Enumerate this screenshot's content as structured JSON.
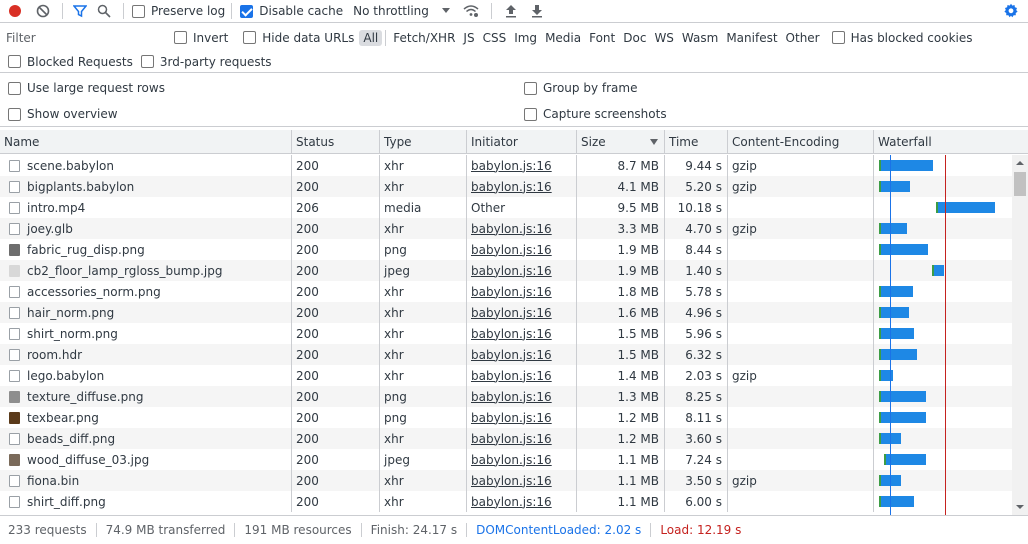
{
  "toolbar": {
    "preserve_log": "Preserve log",
    "disable_cache": "Disable cache",
    "throttling": "No throttling"
  },
  "filterbar": {
    "filter_placeholder": "Filter",
    "invert": "Invert",
    "hide_data_urls": "Hide data URLs",
    "types": [
      "All",
      "Fetch/XHR",
      "JS",
      "CSS",
      "Img",
      "Media",
      "Font",
      "Doc",
      "WS",
      "Wasm",
      "Manifest",
      "Other"
    ],
    "has_blocked_cookies": "Has blocked cookies",
    "blocked_requests": "Blocked Requests",
    "third_party": "3rd-party requests"
  },
  "settings": {
    "large_rows": "Use large request rows",
    "group_by_frame": "Group by frame",
    "show_overview": "Show overview",
    "capture_screenshots": "Capture screenshots"
  },
  "columns": [
    "Name",
    "Status",
    "Type",
    "Initiator",
    "Size",
    "Time",
    "Content-Encoding",
    "Waterfall"
  ],
  "colors": {
    "accent": "#1a73e8",
    "waterfall_bar": "#1e88e5",
    "waiting": "#3c9d45",
    "load": "#c5221f"
  },
  "rows": [
    {
      "name": "scene.babylon",
      "status": "200",
      "type": "xhr",
      "initiator": "babylon.js:16",
      "size": "8.7 MB",
      "time": "9.44 s",
      "encoding": "gzip",
      "icon": "doc",
      "start": 0.02,
      "dur": 0.39
    },
    {
      "name": "bigplants.babylon",
      "status": "200",
      "type": "xhr",
      "initiator": "babylon.js:16",
      "size": "4.1 MB",
      "time": "5.20 s",
      "encoding": "gzip",
      "icon": "doc",
      "start": 0.02,
      "dur": 0.22
    },
    {
      "name": "intro.mp4",
      "status": "206",
      "type": "media",
      "initiator": "Other",
      "size": "9.5 MB",
      "time": "10.18 s",
      "encoding": "",
      "icon": "doc",
      "start": 0.45,
      "dur": 0.42
    },
    {
      "name": "joey.glb",
      "status": "200",
      "type": "xhr",
      "initiator": "babylon.js:16",
      "size": "3.3 MB",
      "time": "4.70 s",
      "encoding": "gzip",
      "icon": "doc",
      "start": 0.02,
      "dur": 0.2
    },
    {
      "name": "fabric_rug_disp.png",
      "status": "200",
      "type": "png",
      "initiator": "babylon.js:16",
      "size": "1.9 MB",
      "time": "8.44 s",
      "encoding": "",
      "icon": "img-dark",
      "start": 0.02,
      "dur": 0.35
    },
    {
      "name": "cb2_floor_lamp_rgloss_bump.jpg",
      "status": "200",
      "type": "jpeg",
      "initiator": "babylon.js:16",
      "size": "1.9 MB",
      "time": "1.40 s",
      "encoding": "",
      "icon": "img-light",
      "start": 0.42,
      "dur": 0.07
    },
    {
      "name": "accessories_norm.png",
      "status": "200",
      "type": "xhr",
      "initiator": "babylon.js:16",
      "size": "1.8 MB",
      "time": "5.78 s",
      "encoding": "",
      "icon": "doc",
      "start": 0.02,
      "dur": 0.24
    },
    {
      "name": "hair_norm.png",
      "status": "200",
      "type": "xhr",
      "initiator": "babylon.js:16",
      "size": "1.6 MB",
      "time": "4.96 s",
      "encoding": "",
      "icon": "doc",
      "start": 0.02,
      "dur": 0.21
    },
    {
      "name": "shirt_norm.png",
      "status": "200",
      "type": "xhr",
      "initiator": "babylon.js:16",
      "size": "1.5 MB",
      "time": "5.96 s",
      "encoding": "",
      "icon": "doc",
      "start": 0.02,
      "dur": 0.25
    },
    {
      "name": "room.hdr",
      "status": "200",
      "type": "xhr",
      "initiator": "babylon.js:16",
      "size": "1.5 MB",
      "time": "6.32 s",
      "encoding": "",
      "icon": "doc",
      "start": 0.02,
      "dur": 0.27
    },
    {
      "name": "lego.babylon",
      "status": "200",
      "type": "xhr",
      "initiator": "babylon.js:16",
      "size": "1.4 MB",
      "time": "2.03 s",
      "encoding": "gzip",
      "icon": "doc",
      "start": 0.02,
      "dur": 0.09
    },
    {
      "name": "texture_diffuse.png",
      "status": "200",
      "type": "png",
      "initiator": "babylon.js:16",
      "size": "1.3 MB",
      "time": "8.25 s",
      "encoding": "",
      "icon": "img-mid",
      "start": 0.02,
      "dur": 0.34
    },
    {
      "name": "texbear.png",
      "status": "200",
      "type": "png",
      "initiator": "babylon.js:16",
      "size": "1.2 MB",
      "time": "8.11 s",
      "encoding": "",
      "icon": "img-brown",
      "start": 0.02,
      "dur": 0.34
    },
    {
      "name": "beads_diff.png",
      "status": "200",
      "type": "xhr",
      "initiator": "babylon.js:16",
      "size": "1.2 MB",
      "time": "3.60 s",
      "encoding": "",
      "icon": "doc",
      "start": 0.02,
      "dur": 0.15
    },
    {
      "name": "wood_diffuse_03.jpg",
      "status": "200",
      "type": "jpeg",
      "initiator": "babylon.js:16",
      "size": "1.1 MB",
      "time": "7.24 s",
      "encoding": "",
      "icon": "img-wood",
      "start": 0.06,
      "dur": 0.3
    },
    {
      "name": "fiona.bin",
      "status": "200",
      "type": "xhr",
      "initiator": "babylon.js:16",
      "size": "1.1 MB",
      "time": "3.50 s",
      "encoding": "gzip",
      "icon": "doc",
      "start": 0.02,
      "dur": 0.15
    },
    {
      "name": "shirt_diff.png",
      "status": "200",
      "type": "xhr",
      "initiator": "babylon.js:16",
      "size": "1.1 MB",
      "time": "6.00 s",
      "encoding": "",
      "icon": "doc",
      "start": 0.02,
      "dur": 0.25
    }
  ],
  "waterfall_markers": {
    "dom_content_loaded": 0.09,
    "load": 0.5
  },
  "status": {
    "requests": "233 requests",
    "transferred": "74.9 MB transferred",
    "resources": "191 MB resources",
    "finish": "Finish: 24.17 s",
    "dcl": "DOMContentLoaded: 2.02 s",
    "load": "Load: 12.19 s"
  }
}
